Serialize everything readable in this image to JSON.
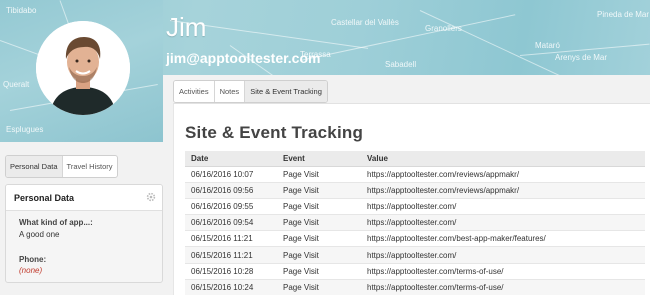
{
  "map": {
    "labels": [
      "Tibidabo",
      "Sant Cugat del Vallès",
      "Castellar del Vallès",
      "Badalona",
      "Granollers",
      "Pineda de Mar",
      "Terrassa",
      "Mataró",
      "Arenys de Mar",
      "Esplugues",
      "Sabadell",
      "Queralt"
    ]
  },
  "user": {
    "name": "Jim",
    "email": "jim@apptooltester.com"
  },
  "main_tabs": [
    {
      "label": "Activities",
      "active": false
    },
    {
      "label": "Notes",
      "active": false
    },
    {
      "label": "Site & Event Tracking",
      "active": true
    }
  ],
  "tracking": {
    "title": "Site & Event Tracking",
    "columns": [
      "Date",
      "Event",
      "Value"
    ],
    "rows": [
      {
        "date": "06/16/2016 10:07",
        "event": "Page Visit",
        "value": "https://apptooltester.com/reviews/appmakr/"
      },
      {
        "date": "06/16/2016 09:56",
        "event": "Page Visit",
        "value": "https://apptooltester.com/reviews/appmakr/"
      },
      {
        "date": "06/16/2016 09:55",
        "event": "Page Visit",
        "value": "https://apptooltester.com/"
      },
      {
        "date": "06/16/2016 09:54",
        "event": "Page Visit",
        "value": "https://apptooltester.com/"
      },
      {
        "date": "06/15/2016 11:21",
        "event": "Page Visit",
        "value": "https://apptooltester.com/best-app-maker/features/"
      },
      {
        "date": "06/15/2016 11:21",
        "event": "Page Visit",
        "value": "https://apptooltester.com/"
      },
      {
        "date": "06/15/2016 10:28",
        "event": "Page Visit",
        "value": "https://apptooltester.com/terms-of-use/"
      },
      {
        "date": "06/15/2016 10:24",
        "event": "Page Visit",
        "value": "https://apptooltester.com/terms-of-use/"
      }
    ]
  },
  "side_tabs": [
    {
      "label": "Personal Data",
      "active": true
    },
    {
      "label": "Travel History",
      "active": false
    }
  ],
  "personal_data": {
    "title": "Personal Data",
    "fields": [
      {
        "label": "What kind of app...:",
        "value": "A good one",
        "empty": false
      },
      {
        "label": "Phone:",
        "value": "(none)",
        "empty": true
      }
    ]
  },
  "colors": {
    "map": "#9ecfd8",
    "empty_value": "#c0392b"
  }
}
